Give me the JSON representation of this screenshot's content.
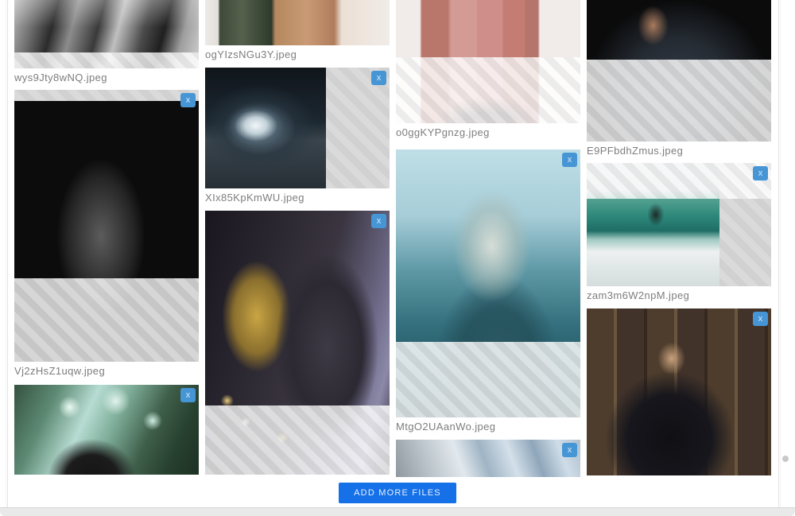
{
  "uploader": {
    "add_more_label": "ADD MORE FILES",
    "remove_glyph": "x",
    "accent_color": "#1670e8",
    "remove_button_color": "#4695d5",
    "caption_color": "#7d7d7d",
    "files": [
      {
        "name": "wys9Jty8wNQ.jpeg"
      },
      {
        "name": "ogYIzsNGu3Y.jpeg"
      },
      {
        "name": "o0ggKYPgnzg.jpeg"
      },
      {
        "name": "E9PFbdhZmus.jpeg"
      },
      {
        "name": "Vj2zHsZ1uqw.jpeg"
      },
      {
        "name": "XIx85KpKmWU.jpeg"
      },
      {
        "name": ""
      },
      {
        "name": "MtgO2UAanWo.jpeg"
      },
      {
        "name": ""
      },
      {
        "name": "zam3m6W2npM.jpeg"
      },
      {
        "name": ""
      },
      {
        "name": ""
      }
    ]
  }
}
